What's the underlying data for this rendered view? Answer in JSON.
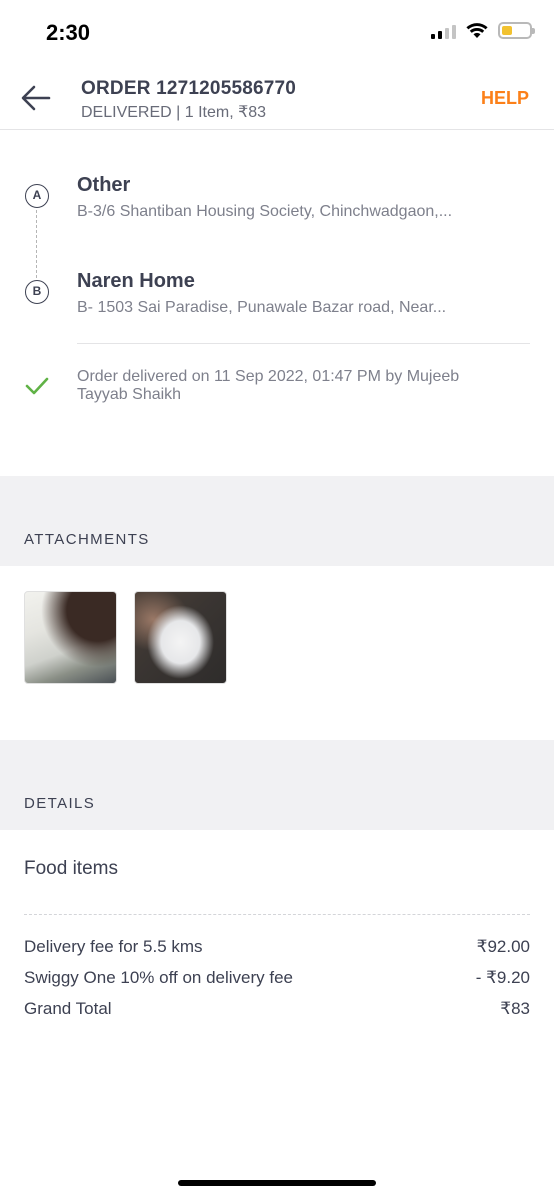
{
  "status_bar": {
    "time": "2:30"
  },
  "header": {
    "title": "ORDER 1271205586770",
    "subtitle": "DELIVERED | 1 Item, ₹83",
    "help_label": "HELP"
  },
  "route": {
    "pickup": {
      "marker": "A",
      "name": "Other",
      "address": "B-3/6 Shantiban Housing Society, Chinchwadgaon,..."
    },
    "drop": {
      "marker": "B",
      "name": "Naren Home",
      "address": "B- 1503 Sai Paradise, Punawale Bazar road,  Near..."
    },
    "delivery_status": "Order delivered on 11 Sep 2022, 01:47 PM by Mujeeb Tayyab Shaikh"
  },
  "attachments": {
    "title": "ATTACHMENTS"
  },
  "details": {
    "title": "DETAILS",
    "section_title": "Food items",
    "rows": [
      {
        "label": "Delivery fee for 5.5 kms",
        "value": "₹92.00"
      },
      {
        "label": "Swiggy One 10% off on delivery fee",
        "value": "- ₹9.20"
      },
      {
        "label": "Grand Total",
        "value": "₹83"
      }
    ]
  },
  "colors": {
    "accent": "#fc8019",
    "success": "#60b246",
    "text": "#3d4152",
    "muted": "#7e808c"
  }
}
